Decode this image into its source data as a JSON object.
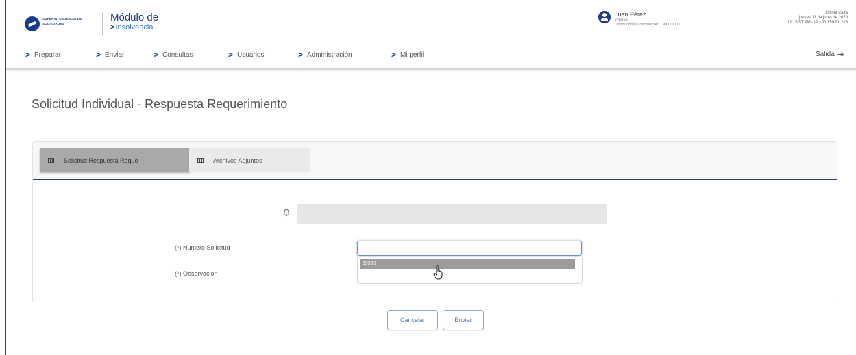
{
  "header": {
    "logo_text": "SUPERINTENDENCIA DE SOCIEDADES",
    "module_title": "Módulo de",
    "module_subtitle": "Insolvencia",
    "user": {
      "name": "Juan Pérez",
      "code": "JPEREZ",
      "company": "Distribuciones Colombia SAS - 900000000"
    },
    "last_visit": {
      "label": "Última visita",
      "date": "jueves 11 de junio de 2020",
      "time": "12:16:57 PM - IP 190.159.91.215"
    }
  },
  "nav": {
    "items": [
      {
        "label": "Preparar"
      },
      {
        "label": "Enviar"
      },
      {
        "label": "Consultas"
      },
      {
        "label": "Usuarios"
      },
      {
        "label": "Administración"
      },
      {
        "label": "Mi perfil"
      }
    ],
    "exit_label": "Salida"
  },
  "main": {
    "page_title": "Solicitud Individual - Respuesta Requerimiento",
    "tabs": [
      {
        "label": "Solicitud Respuesta Reque",
        "active": true
      },
      {
        "label": "Archivos Adjuntos",
        "active": false
      }
    ],
    "form": {
      "numero_label": "(*) Numero Solicitud",
      "numero_value": "",
      "dropdown_option": "19396",
      "observacion_label": "(*) Observacion"
    },
    "buttons": {
      "cancel": "Cancelar",
      "send": "Enviar"
    }
  },
  "colors": {
    "brand": "#1b3b8f",
    "accent": "#3a76c4",
    "tab_active": "#a9a9a9",
    "button_border": "#8aa6d6"
  }
}
